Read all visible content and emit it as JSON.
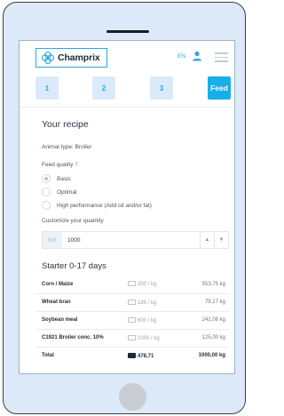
{
  "header": {
    "brand": "Champrix",
    "lang": "EN"
  },
  "steps": [
    {
      "label": "1"
    },
    {
      "label": "2"
    },
    {
      "label": "3"
    },
    {
      "label": "Feed"
    }
  ],
  "recipe": {
    "title": "Your recipe",
    "animal_type": "Animal type: Broiler",
    "feed_quality_label": "Feed quality",
    "help_mark": "?",
    "options": [
      "Basic",
      "Optimal",
      "High performance (Add oil and/or fat)"
    ],
    "selected_option": "Basic",
    "customize_label": "Customize your quantity",
    "quantity_unit": "KG",
    "quantity_value": "1000"
  },
  "phase": {
    "title": "Starter 0-17 days",
    "rows": [
      {
        "name": "Corn / Maize",
        "price": "350 / kg",
        "quantity": "553,75 kg"
      },
      {
        "name": "Wheat bran",
        "price": "185 / kg",
        "quantity": "79,17 kg"
      },
      {
        "name": "Soybean meal",
        "price": "600 / kg",
        "quantity": "242,08 kg"
      },
      {
        "name": "C1921 Broiler conc. 10%",
        "price": "1000 / kg",
        "quantity": "125,00 kg"
      }
    ],
    "total": {
      "name": "Total",
      "price": "478,71",
      "quantity": "1000,00 kg"
    }
  },
  "colors": {
    "accent": "#19aeea",
    "step_bg": "#dbeafb",
    "phone_bg": "#dbe9f9"
  },
  "icons": {
    "user": "user-icon",
    "menu": "menu-icon",
    "logo": "champrix-logo-icon",
    "money": "banknote-icon"
  }
}
